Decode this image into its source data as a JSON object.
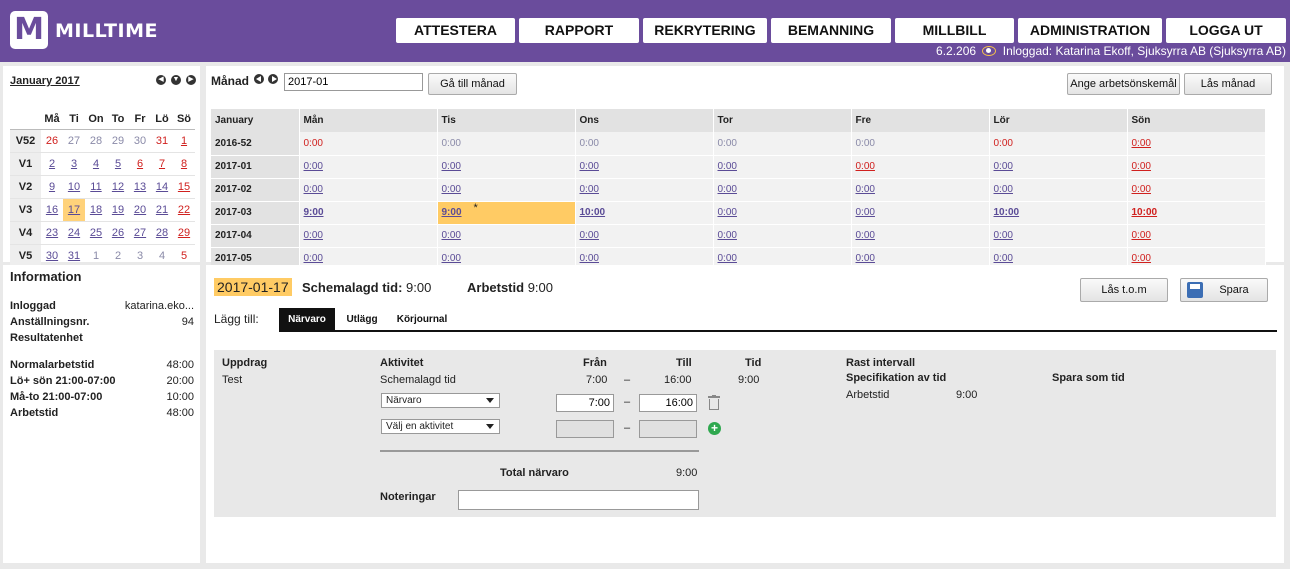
{
  "app": {
    "logo_letter": "M",
    "name": "MILLTIME",
    "version": "6.2.206",
    "user_text": "Inloggad: Katarina Ekoff, Sjuksyrra AB (Sjuksyrra AB)"
  },
  "nav": [
    "ATTESTERA",
    "RAPPORT",
    "REKRYTERING",
    "BEMANNING",
    "MILLBILL",
    "ADMINISTRATION",
    "LOGGA UT"
  ],
  "calendar": {
    "title": "January 2017",
    "days": [
      "Må",
      "Ti",
      "On",
      "To",
      "Fr",
      "Lö",
      "Sö"
    ],
    "weeks": [
      {
        "wk": "V52",
        "d": [
          [
            "26",
            "r"
          ],
          [
            "27",
            "g"
          ],
          [
            "28",
            "g"
          ],
          [
            "29",
            "g"
          ],
          [
            "30",
            "g"
          ],
          [
            "31",
            "r"
          ],
          [
            "1",
            "rd"
          ]
        ]
      },
      {
        "wk": "V1",
        "d": [
          [
            "2",
            "l"
          ],
          [
            "3",
            "l"
          ],
          [
            "4",
            "l"
          ],
          [
            "5",
            "l"
          ],
          [
            "6",
            "rd"
          ],
          [
            "7",
            "rd"
          ],
          [
            "8",
            "rd"
          ]
        ]
      },
      {
        "wk": "V2",
        "d": [
          [
            "9",
            "l"
          ],
          [
            "10",
            "l"
          ],
          [
            "11",
            "l"
          ],
          [
            "12",
            "l"
          ],
          [
            "13",
            "l"
          ],
          [
            "14",
            "l"
          ],
          [
            "15",
            "rd"
          ]
        ]
      },
      {
        "wk": "V3",
        "d": [
          [
            "16",
            "l"
          ],
          [
            "17",
            "l"
          ],
          [
            "18",
            "l"
          ],
          [
            "19",
            "l"
          ],
          [
            "20",
            "l"
          ],
          [
            "21",
            "l"
          ],
          [
            "22",
            "rd"
          ]
        ]
      },
      {
        "wk": "V4",
        "d": [
          [
            "23",
            "l"
          ],
          [
            "24",
            "l"
          ],
          [
            "25",
            "l"
          ],
          [
            "26",
            "l"
          ],
          [
            "27",
            "l"
          ],
          [
            "28",
            "l"
          ],
          [
            "29",
            "rd"
          ]
        ]
      },
      {
        "wk": "V5",
        "d": [
          [
            "30",
            "l"
          ],
          [
            "31",
            "l"
          ],
          [
            "1",
            "g"
          ],
          [
            "2",
            "g"
          ],
          [
            "3",
            "g"
          ],
          [
            "4",
            "g"
          ],
          [
            "5",
            "r"
          ]
        ]
      }
    ]
  },
  "info": {
    "title": "Information",
    "rows": [
      {
        "k": "Inloggad",
        "v": "katarina.eko..."
      },
      {
        "k": "Anställningsnr.",
        "v": "94"
      },
      {
        "k": "Resultatenhet",
        "v": ""
      },
      {
        "k": "Normalarbetstid",
        "v": "48:00"
      },
      {
        "k": "Lö+ sön 21:00-07:00",
        "v": "20:00"
      },
      {
        "k": "Må-to 21:00-07:00",
        "v": "10:00"
      },
      {
        "k": "Arbetstid",
        "v": "48:00"
      }
    ]
  },
  "month": {
    "label": "Månad",
    "input": "2017-01",
    "goto": "Gå till månad",
    "wish_btn": "Ange arbetsönskemål",
    "lock_btn": "Lås månad",
    "headers": [
      "January",
      "Mån",
      "Tis",
      "Ons",
      "Tor",
      "Fre",
      "Lör",
      "Sön"
    ],
    "rows": [
      {
        "w": "2016-52",
        "c": [
          [
            "0:00",
            "r"
          ],
          [
            "0:00",
            "g"
          ],
          [
            "0:00",
            "g"
          ],
          [
            "0:00",
            "g"
          ],
          [
            "0:00",
            "g"
          ],
          [
            "0:00",
            "r"
          ],
          [
            "0:00",
            "rd"
          ]
        ]
      },
      {
        "w": "2017-01",
        "c": [
          [
            "0:00",
            "l"
          ],
          [
            "0:00",
            "l"
          ],
          [
            "0:00",
            "l"
          ],
          [
            "0:00",
            "l"
          ],
          [
            "0:00",
            "rd"
          ],
          [
            "0:00",
            "l"
          ],
          [
            "0:00",
            "rd"
          ]
        ]
      },
      {
        "w": "2017-02",
        "c": [
          [
            "0:00",
            "l"
          ],
          [
            "0:00",
            "l"
          ],
          [
            "0:00",
            "l"
          ],
          [
            "0:00",
            "l"
          ],
          [
            "0:00",
            "l"
          ],
          [
            "0:00",
            "l"
          ],
          [
            "0:00",
            "rd"
          ]
        ]
      },
      {
        "w": "2017-03",
        "c": [
          [
            "9:00",
            "lb"
          ],
          [
            "9:00",
            "lb"
          ],
          [
            "10:00",
            "lb"
          ],
          [
            "0:00",
            "l"
          ],
          [
            "0:00",
            "l"
          ],
          [
            "10:00",
            "lb"
          ],
          [
            "10:00",
            "rdb"
          ]
        ]
      },
      {
        "w": "2017-04",
        "c": [
          [
            "0:00",
            "l"
          ],
          [
            "0:00",
            "l"
          ],
          [
            "0:00",
            "l"
          ],
          [
            "0:00",
            "l"
          ],
          [
            "0:00",
            "l"
          ],
          [
            "0:00",
            "l"
          ],
          [
            "0:00",
            "rd"
          ]
        ]
      },
      {
        "w": "2017-05",
        "c": [
          [
            "0:00",
            "l"
          ],
          [
            "0:00",
            "l"
          ],
          [
            "0:00",
            "l"
          ],
          [
            "0:00",
            "l"
          ],
          [
            "0:00",
            "l"
          ],
          [
            "0:00",
            "l"
          ],
          [
            "0:00",
            "rd"
          ]
        ]
      }
    ],
    "star": "*"
  },
  "day": {
    "date": "2017-01-17",
    "sched_label": "Schemalagd tid:",
    "sched_val": "9:00",
    "work_label": "Arbetstid",
    "work_val": "9:00",
    "lock_btn": "Lås t.o.m",
    "save_btn": "Spara",
    "add_label": "Lägg till:",
    "tabs": [
      "Närvaro",
      "Utlägg",
      "Körjournal"
    ],
    "cols": {
      "uppdrag": "Uppdrag",
      "aktivitet": "Aktivitet",
      "fran": "Från",
      "till": "Till",
      "tid": "Tid",
      "rast": "Rast intervall",
      "spec": "Specifikation av tid",
      "spara": "Spara som tid"
    },
    "uppdrag_val": "Test",
    "sched_row": {
      "akt": "Schemalagd tid",
      "fran": "7:00",
      "till": "16:00",
      "tid": "9:00"
    },
    "act1": "Närvaro",
    "act1_from": "7:00",
    "act1_to": "16:00",
    "act2": "Välj en aktivitet",
    "dash": "–",
    "spec_label": "Arbetstid",
    "spec_val": "9:00",
    "total_label": "Total närvaro",
    "total_val": "9:00",
    "notes_label": "Noteringar"
  }
}
